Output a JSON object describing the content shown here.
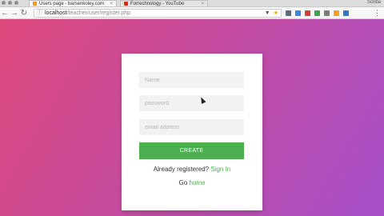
{
  "browser": {
    "tabs": [
      {
        "title": "Users page - barsenkoley.com",
        "active": true
      },
      {
        "title": "Forrechnology - YouTube",
        "active": false
      }
    ],
    "profile_label": "Scriba",
    "url_host": "localhost",
    "url_path": "/teacher/user/register.php"
  },
  "form": {
    "name_placeholder": "Name",
    "password_placeholder": "password",
    "email_placeholder": "email address",
    "create_label": "CREATE",
    "registered_text": "Already registered?",
    "signin_link": "Sign In",
    "go_text": "Go",
    "home_link": "home"
  },
  "colors": {
    "accent": "#4caf50",
    "background_start": "#e0497a",
    "background_end": "#a64fc9"
  }
}
